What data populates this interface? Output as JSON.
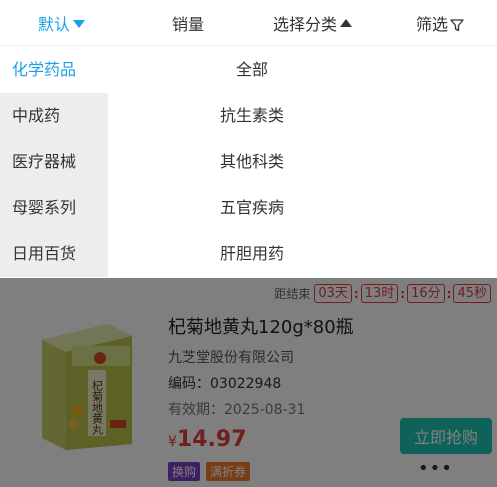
{
  "sort_bar": {
    "default_label": "默认",
    "sales_label": "销量",
    "category_label": "选择分类",
    "filter_label": "筛选"
  },
  "categories": {
    "left": [
      "化学药品",
      "中成药",
      "医疗器械",
      "母婴系列",
      "日用百货"
    ],
    "right": [
      "全部",
      "抗生素类",
      "其他科类",
      "五官疾病",
      "肝胆用药"
    ]
  },
  "countdown": {
    "label": "距结束",
    "days": "03天",
    "hours": "13时",
    "minutes": "16分",
    "seconds": "45秒"
  },
  "product": {
    "name": "杞菊地黄丸120g*80瓶",
    "manufacturer": "九芝堂股份有限公司",
    "code": "编码：03022948",
    "expiry": "有效期：2025-08-31",
    "price_symbol": "¥",
    "price": "14.97",
    "tag_swap": "换购",
    "tag_coupon": "满折券",
    "buy_label": "立即抢购",
    "more_label": "•••",
    "box_text": "杞菊地黄丸"
  },
  "colors": {
    "accent": "#1aa0e8",
    "price": "#e23c3c",
    "buy": "#1cc4b4"
  }
}
